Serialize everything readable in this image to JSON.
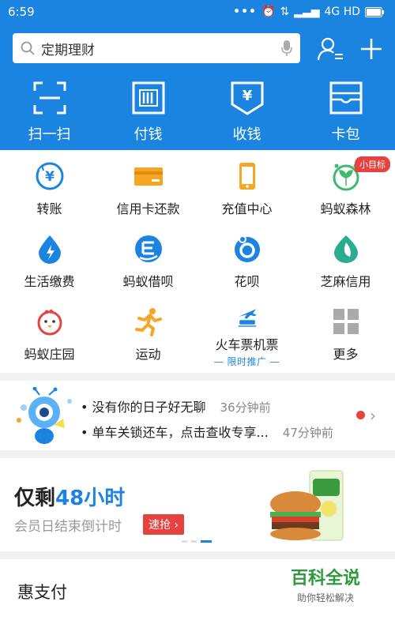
{
  "status_bar": {
    "time": "6:59",
    "dots": "•••",
    "network": "4G HD"
  },
  "search": {
    "placeholder": "定期理财"
  },
  "quick_actions": [
    {
      "label": "扫一扫",
      "icon": "scan-icon"
    },
    {
      "label": "付钱",
      "icon": "pay-barcode-icon"
    },
    {
      "label": "收钱",
      "icon": "receive-money-icon"
    },
    {
      "label": "卡包",
      "icon": "card-wallet-icon"
    }
  ],
  "services": [
    {
      "label": "转账",
      "icon": "transfer-icon"
    },
    {
      "label": "信用卡还款",
      "icon": "credit-card-icon"
    },
    {
      "label": "充值中心",
      "icon": "phone-recharge-icon"
    },
    {
      "label": "蚂蚁森林",
      "icon": "sprout-icon",
      "badge": "小目标"
    },
    {
      "label": "生活缴费",
      "icon": "utility-drop-icon"
    },
    {
      "label": "蚂蚁借呗",
      "icon": "loan-icon"
    },
    {
      "label": "花呗",
      "icon": "huabei-icon"
    },
    {
      "label": "芝麻信用",
      "icon": "sesame-credit-icon"
    },
    {
      "label": "蚂蚁庄园",
      "icon": "chicken-icon"
    },
    {
      "label": "运动",
      "icon": "running-icon"
    },
    {
      "label": "火车票机票",
      "icon": "train-plane-icon",
      "promo": "— 限时推广 —"
    },
    {
      "label": "更多",
      "icon": "more-grid-icon"
    }
  ],
  "messages": [
    {
      "text": "没有你的日子好无聊",
      "time": "36分钟前"
    },
    {
      "text": "单车关锁还车，点击查收专享...",
      "time": "47分钟前"
    }
  ],
  "banner": {
    "title_prefix": "仅剩",
    "title_highlight": "48小时",
    "subtitle": "会员日结束倒计时",
    "button": "速抢 ›"
  },
  "section": {
    "title": "惠支付"
  },
  "watermark": {
    "title": "百科全说",
    "subtitle": "助你轻松解决"
  },
  "colors": {
    "brand_blue": "#1a84e0",
    "badge_red": "#e64340",
    "orange": "#f5a623"
  }
}
